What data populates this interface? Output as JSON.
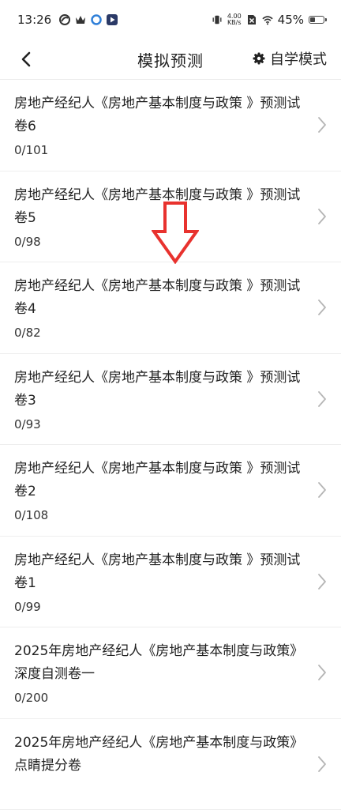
{
  "status_bar": {
    "time": "13:26",
    "net_speed_value": "4.00",
    "net_speed_unit": "KB/s",
    "battery": "45%",
    "battery_level": 0.45
  },
  "nav": {
    "title": "模拟预测",
    "mode_label": "自学模式"
  },
  "items": [
    {
      "title": "房地产经纪人《房地产基本制度与政策 》预测试卷6",
      "progress": "0/101"
    },
    {
      "title": "房地产经纪人《房地产基本制度与政策 》预测试卷5",
      "progress": "0/98"
    },
    {
      "title": "房地产经纪人《房地产基本制度与政策 》预测试卷4",
      "progress": "0/82"
    },
    {
      "title": "房地产经纪人《房地产基本制度与政策 》预测试卷3",
      "progress": "0/93"
    },
    {
      "title": "房地产经纪人《房地产基本制度与政策 》预测试卷2",
      "progress": "0/108"
    },
    {
      "title": "房地产经纪人《房地产基本制度与政策 》预测试卷1",
      "progress": "0/99"
    },
    {
      "title": "2025年房地产经纪人《房地产基本制度与政策》深度自测卷一",
      "progress": "0/200"
    },
    {
      "title": "2025年房地产经纪人《房地产基本制度与政策》点睛提分卷",
      "progress": ""
    }
  ],
  "annotation": {
    "color": "#e8322e"
  }
}
